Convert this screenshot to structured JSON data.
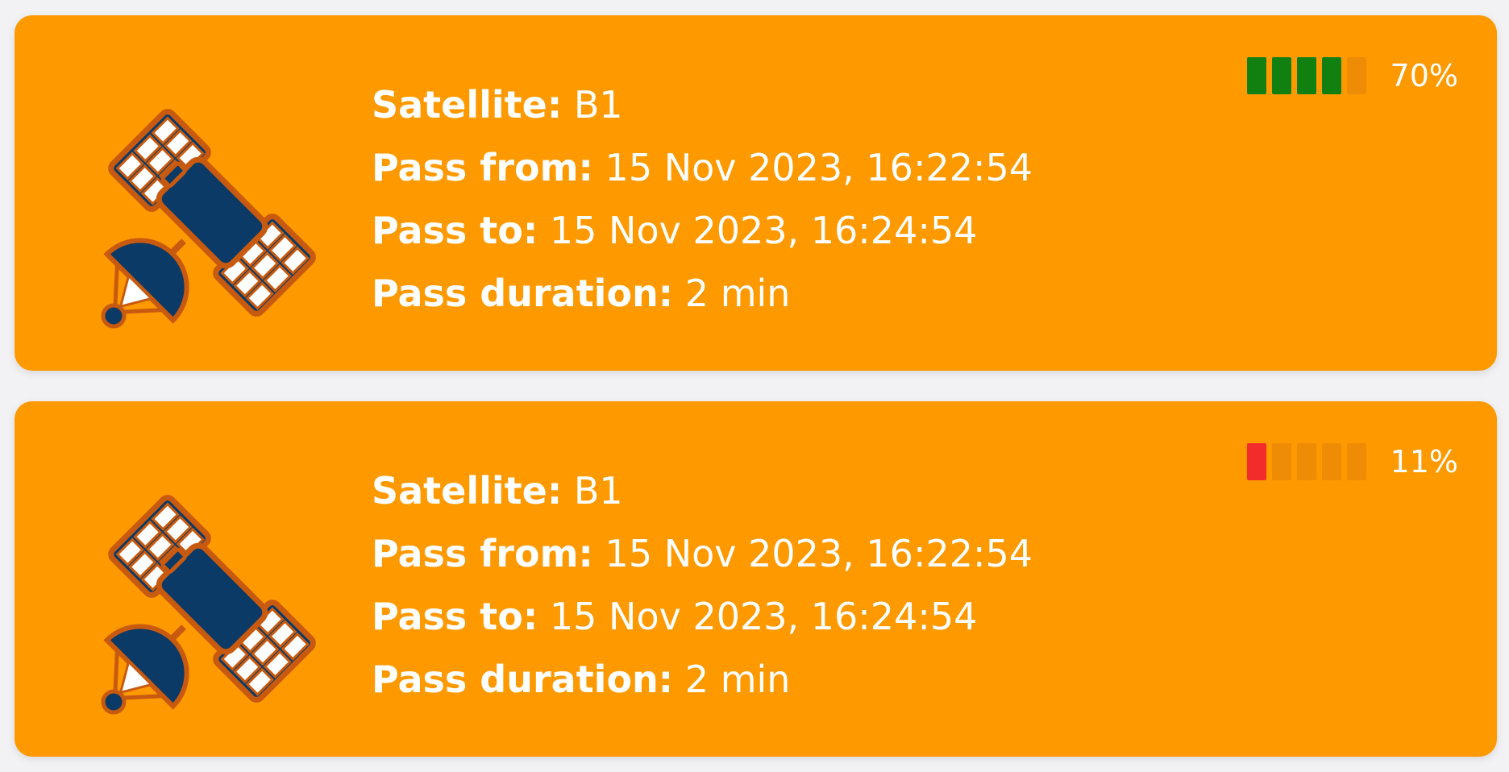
{
  "colors": {
    "card_background": "#fe9900",
    "text": "#ffffff",
    "bar_good": "#128011",
    "bar_bad": "#f22b2b",
    "bar_empty": "#ef8c06",
    "icon_body": "#0b3a66",
    "icon_outline": "#c85a10"
  },
  "labels": {
    "satellite": "Satellite:",
    "pass_from": "Pass from:",
    "pass_to": "Pass to:",
    "pass_duration": "Pass duration:"
  },
  "passes": [
    {
      "icon": "satellite-icon",
      "satellite": "B1",
      "pass_from": "15 Nov 2023, 16:22:54",
      "pass_to": "15 Nov 2023, 16:24:54",
      "pass_duration": "2 min",
      "signal_percent": 70,
      "signal_text": "70%",
      "signal_filled_bars": 4,
      "signal_total_bars": 5,
      "signal_level": "good"
    },
    {
      "icon": "satellite-icon",
      "satellite": "B1",
      "pass_from": "15 Nov 2023, 16:22:54",
      "pass_to": "15 Nov 2023, 16:24:54",
      "pass_duration": "2 min",
      "signal_percent": 11,
      "signal_text": "11%",
      "signal_filled_bars": 1,
      "signal_total_bars": 5,
      "signal_level": "bad"
    }
  ]
}
